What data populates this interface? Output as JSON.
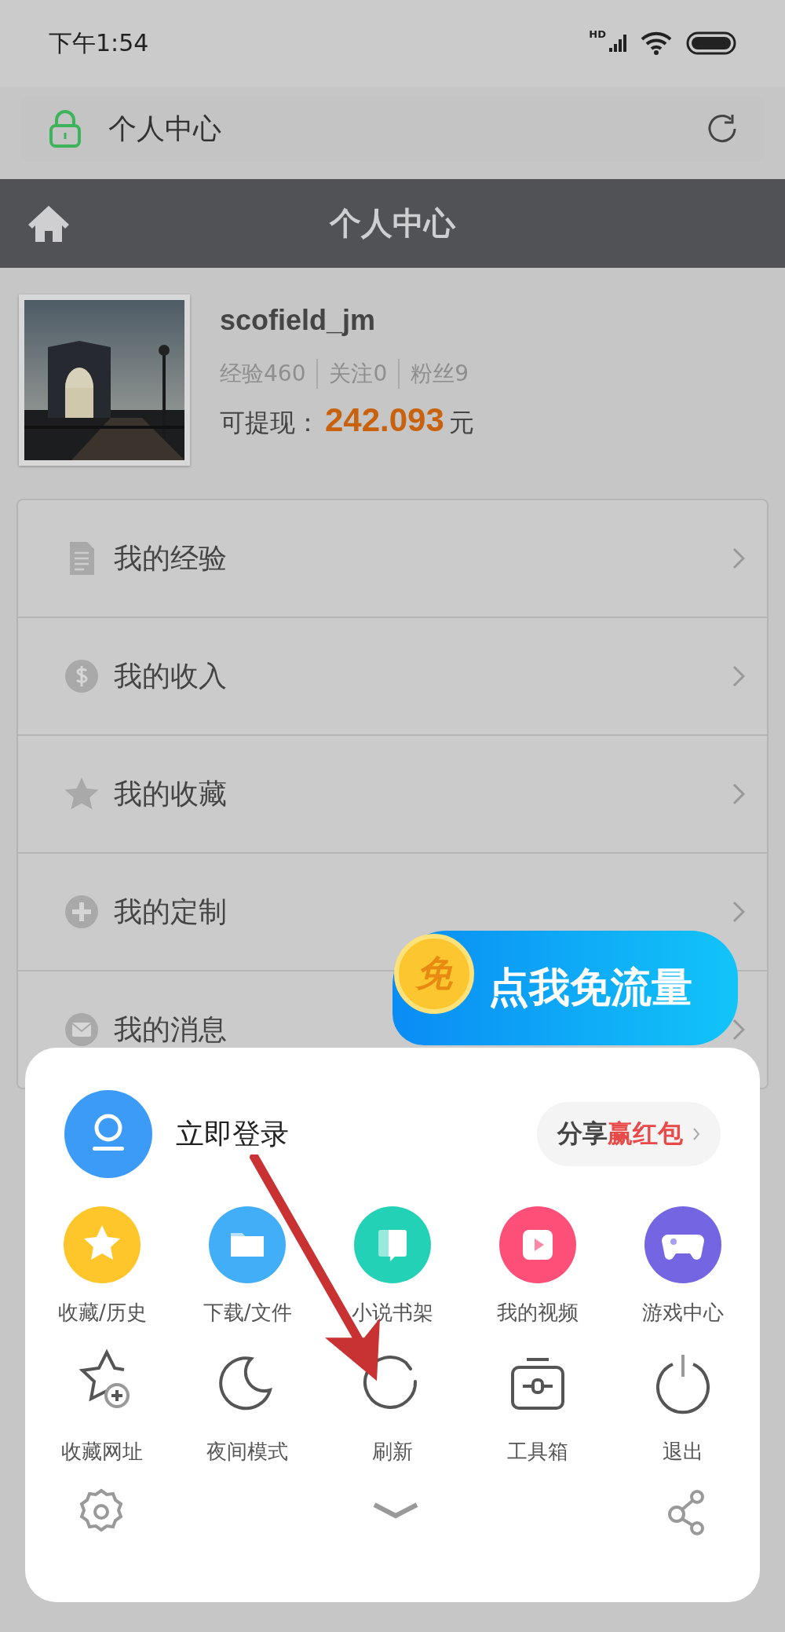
{
  "status_bar": {
    "time": "下午1:54",
    "network_label": "HD"
  },
  "address_bar": {
    "title": "个人中心"
  },
  "header": {
    "title": "个人中心"
  },
  "profile": {
    "username": "scofield_jm",
    "stats": [
      "经验460",
      "关注0",
      "粉丝9"
    ],
    "balance_label": "可提现：",
    "balance": "242.093",
    "balance_unit": "元"
  },
  "menu": [
    {
      "label": "我的经验"
    },
    {
      "label": "我的收入"
    },
    {
      "label": "我的收藏"
    },
    {
      "label": "我的定制"
    },
    {
      "label": "我的消息"
    }
  ],
  "promo_badge": {
    "coin": "免",
    "text": "点我免流量"
  },
  "sheet": {
    "login": "立即登录",
    "share_label": "分享",
    "share_highlight": "赢红包",
    "items": [
      {
        "kind": "filled",
        "color": "#ffc62b",
        "label": "收藏/历史"
      },
      {
        "kind": "filled",
        "color": "#42aef8",
        "label": "下载/文件"
      },
      {
        "kind": "filled",
        "color": "#23d1b6",
        "label": "小说书架"
      },
      {
        "kind": "filled",
        "color": "#fd4f78",
        "label": "我的视频"
      },
      {
        "kind": "filled",
        "color": "#7465e3",
        "label": "游戏中心"
      },
      {
        "kind": "outline",
        "label": "收藏网址"
      },
      {
        "kind": "outline",
        "label": "夜间模式"
      },
      {
        "kind": "outline",
        "label": "刷新"
      },
      {
        "kind": "outline",
        "label": "工具箱"
      },
      {
        "kind": "outline",
        "label": "退出"
      }
    ]
  }
}
